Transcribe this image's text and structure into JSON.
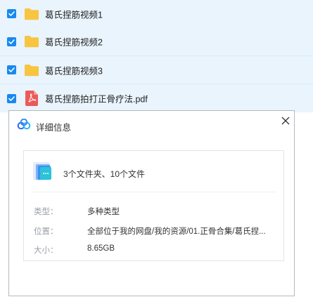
{
  "files": [
    {
      "name": "葛氏捏筋视频1",
      "type": "folder",
      "checked": true
    },
    {
      "name": "葛氏捏筋视频2",
      "type": "folder",
      "checked": true
    },
    {
      "name": "葛氏捏筋视频3",
      "type": "folder",
      "checked": true
    },
    {
      "name": "葛氏捏筋拍打正骨疗法.pdf",
      "type": "pdf",
      "checked": true
    }
  ],
  "dialog": {
    "title": "详细信息",
    "summary": "3个文件夹、10个文件",
    "type_label": "类型：",
    "type_value": "多种类型",
    "location_label": "位置：",
    "location_value": "全部位于我的网盘/我的资源/01.正骨合集/葛氏捏...",
    "size_label": "大小：",
    "size_value": "8.65GB"
  },
  "colors": {
    "row_background": "#e9f4fd",
    "checkbox": "#1789f0",
    "folder": "#f8c541",
    "pdf": "#ea5a5a"
  }
}
